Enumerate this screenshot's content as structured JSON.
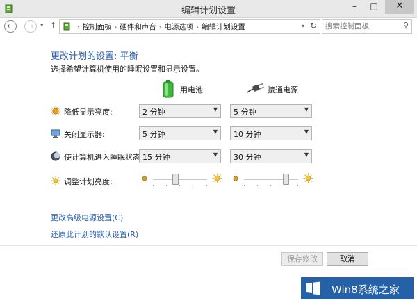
{
  "window": {
    "title": "编辑计划设置",
    "minimize_glyph": "–",
    "maximize_glyph": "□",
    "close_glyph": "✕"
  },
  "nav": {
    "back_glyph": "←",
    "forward_glyph": "→",
    "dropdown_glyph": "▾",
    "up_glyph": "↑",
    "breadcrumbs": [
      "控制面板",
      "硬件和声音",
      "电源选项",
      "编辑计划设置"
    ],
    "breadcrumb_separator": "›",
    "refresh_glyph": "↻",
    "search_placeholder": "搜索控制面板",
    "search_glyph": "⚲"
  },
  "content": {
    "heading": "更改计划的设置: 平衡",
    "subheading": "选择希望计算机使用的睡眠设置和显示设置。",
    "columns": {
      "battery_label": "用电池",
      "plugged_label": "接通电源"
    },
    "rows": [
      {
        "label": "降低显示亮度:",
        "battery": "2 分钟",
        "plugged": "5 分钟"
      },
      {
        "label": "关闭显示器:",
        "battery": "5 分钟",
        "plugged": "10 分钟"
      },
      {
        "label": "使计算机进入睡眠状态:",
        "battery": "15 分钟",
        "plugged": "30 分钟"
      }
    ],
    "brightness": {
      "label": "调整计划亮度:",
      "battery_level": 0.42,
      "plugged_level": 0.78
    },
    "links": {
      "advanced": "更改高级电源设置(C)",
      "restore": "还原此计划的默认设置(R)"
    }
  },
  "buttons": {
    "save": "保存修改",
    "cancel": "取消"
  },
  "watermark": {
    "text": "Win8系统之家"
  },
  "icons": {
    "app": "control-panel-icon",
    "dim": "dim-display-icon",
    "display": "monitor-icon",
    "sleep": "moon-icon",
    "brightness": "sun-icon",
    "battery": "battery-icon",
    "plug": "power-plug-icon",
    "windows_logo": "windows-logo-icon"
  },
  "colors": {
    "accent": "#2a5db0",
    "watermark_bg": "#2461a8",
    "battery_green": "#3cb83a"
  }
}
